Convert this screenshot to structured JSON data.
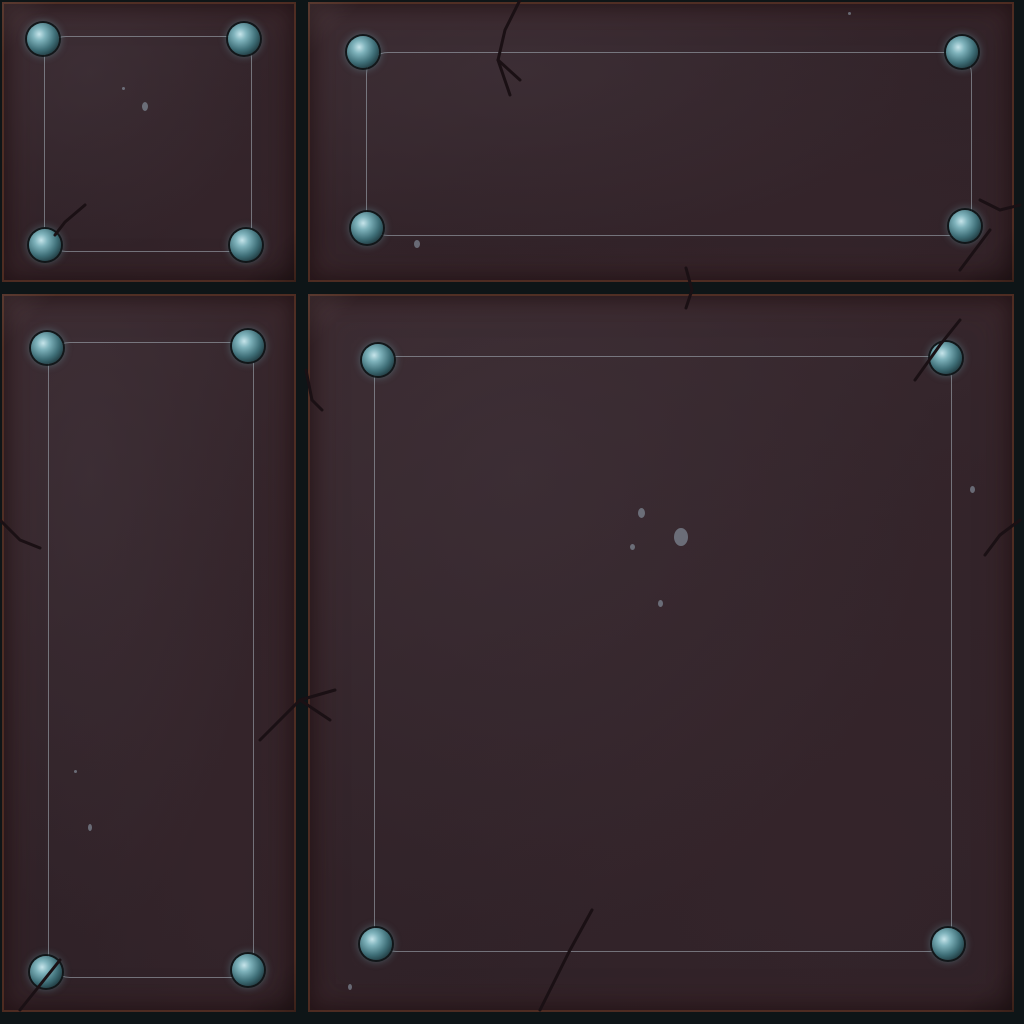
{
  "scene": {
    "description_free": true,
    "colors": {
      "seam": "#0e1517",
      "plate_base": "#33242a",
      "plate_edge_rust": "#6e3e28",
      "inner_border": "#aab4be",
      "rivet_glow": "#7fb3bc",
      "crack": "#1a1014"
    },
    "plates": [
      {
        "id": "top-left"
      },
      {
        "id": "top-right"
      },
      {
        "id": "bottom-left"
      },
      {
        "id": "bottom-right"
      }
    ]
  }
}
